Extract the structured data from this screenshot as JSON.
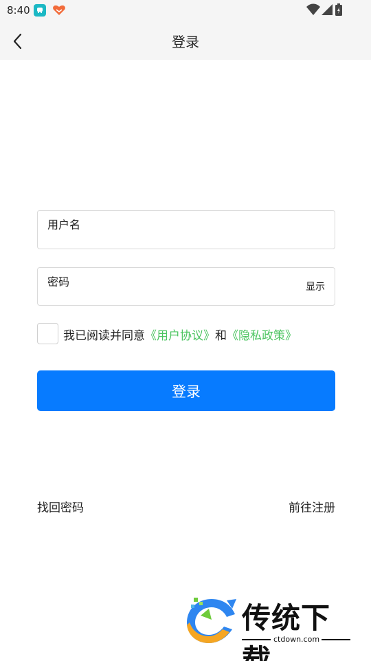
{
  "status_bar": {
    "time": "8:40",
    "icons": [
      "app-notification-icon",
      "heart-app-icon",
      "wifi-icon",
      "cellular-signal-icon",
      "battery-icon"
    ]
  },
  "app_bar": {
    "back_icon": "chevron-left-icon",
    "title": "登录"
  },
  "form": {
    "username_placeholder": "用户名",
    "password_placeholder": "密码",
    "show_password_label": "显示",
    "agreement": {
      "prefix": "我已阅读并同意",
      "user_agreement_link": "《用户协议》",
      "connector": "和",
      "privacy_link": "《隐私政策》",
      "checked": false
    },
    "login_button": "登录"
  },
  "footer_links": {
    "forgot_password": "找回密码",
    "register": "前往注册"
  },
  "watermark": {
    "brand": "传统下载",
    "site": "ctdown.com"
  },
  "colors": {
    "primary": "#077bff",
    "link": "#4cc460",
    "app_bar_bg": "#f5f5f5",
    "border": "#d9d9d9"
  }
}
